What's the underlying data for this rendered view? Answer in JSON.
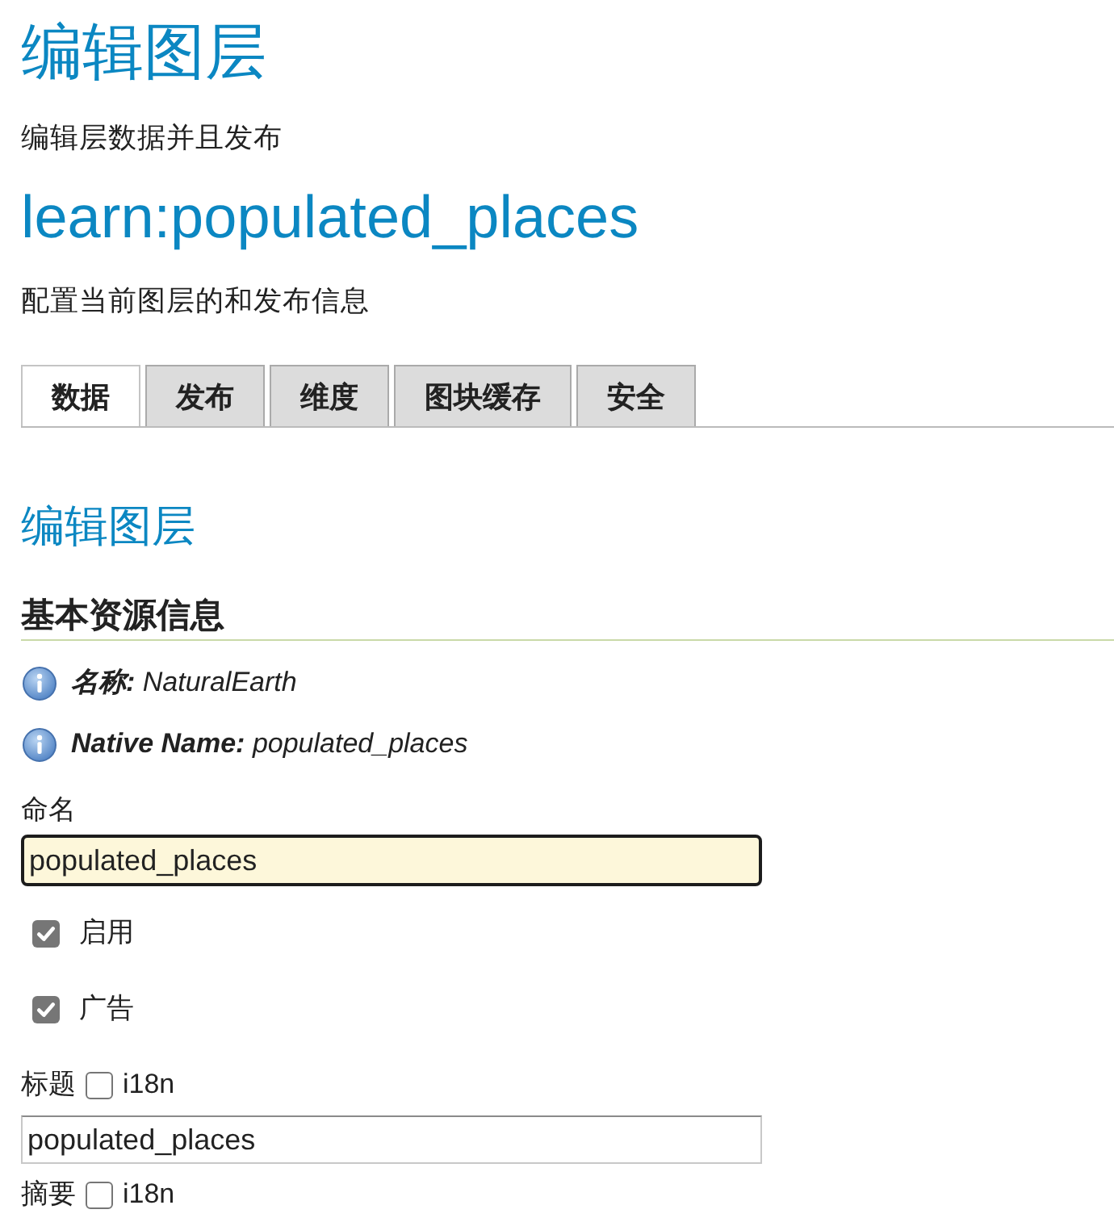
{
  "page": {
    "title": "编辑图层",
    "subtitle": "编辑层数据并且发布"
  },
  "layer": {
    "name": "learn:populated_places",
    "description": "配置当前图层的和发布信息"
  },
  "tabs": [
    {
      "label": "数据",
      "selected": true
    },
    {
      "label": "发布",
      "selected": false
    },
    {
      "label": "维度",
      "selected": false
    },
    {
      "label": "图块缓存",
      "selected": false
    },
    {
      "label": "安全",
      "selected": false
    }
  ],
  "section": {
    "title": "编辑图层",
    "heading": "基本资源信息"
  },
  "info": [
    {
      "text": "**名称:** NaturalEarth"
    },
    {
      "text": "**Native Name:** populated_places"
    }
  ],
  "form": [
    {
      "kind": "text",
      "label": "命名",
      "value": "populated_places",
      "focused": true
    },
    {
      "kind": "checkbox",
      "label": "启用",
      "checked": true
    },
    {
      "kind": "checkbox",
      "label": "广告",
      "checked": true
    },
    {
      "kind": "i18n",
      "label": "标题",
      "toggle": "i18n",
      "checked": false,
      "value": "populated_places",
      "focused": false
    },
    {
      "kind": "i18n",
      "label": "摘要",
      "toggle": "i18n",
      "checked": false
    }
  ]
}
